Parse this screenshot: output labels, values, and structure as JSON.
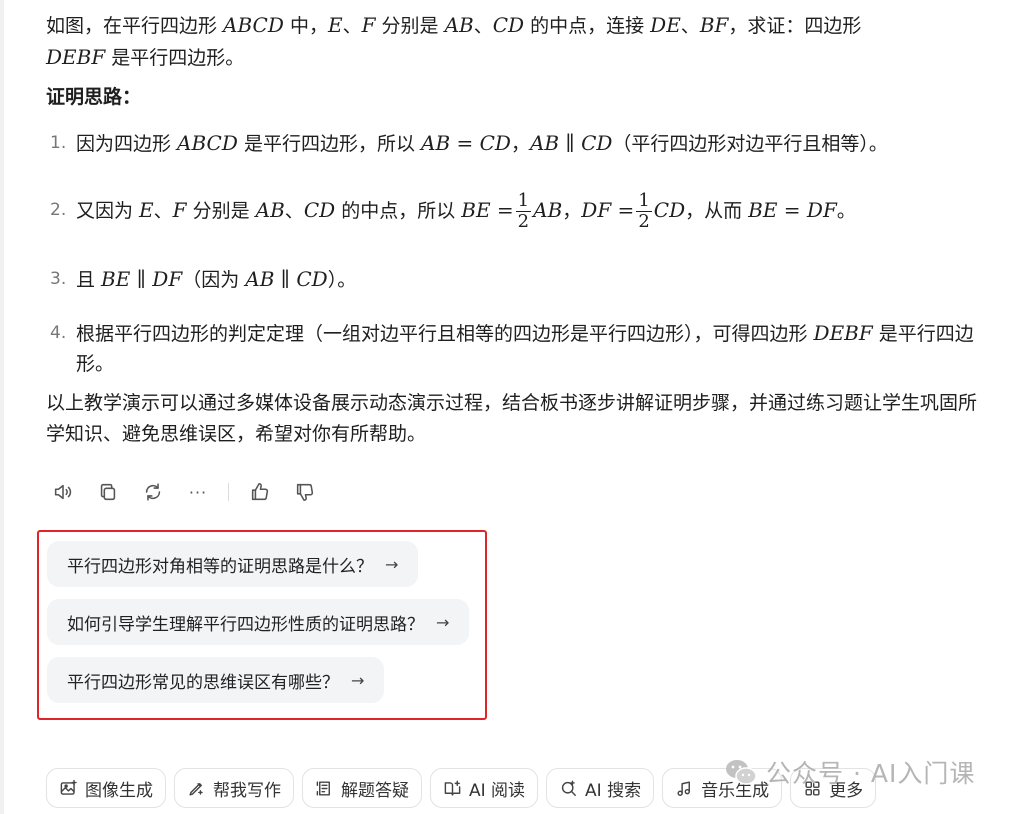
{
  "problem": {
    "t1": "如图，在平行四边形 ",
    "m1": "ABCD",
    "t2": " 中，",
    "m2": "E",
    "t3": "、",
    "m3": "F",
    "t4": " 分别是 ",
    "m4": "AB",
    "t5": "、",
    "m5": "CD",
    "t6": " 的中点，连接 ",
    "m6": "DE",
    "t7": "、",
    "m7": "BF",
    "t8": "，求证：四边形",
    "m8": "DEBF",
    "t9": " 是平行四边形。"
  },
  "heading": {
    "label": "证明思路",
    "colon": "："
  },
  "steps": [
    {
      "number": "1.",
      "a": "因为四边形 ",
      "m1": "ABCD",
      "b": " 是平行四边形，所以 ",
      "m2": "AB = CD",
      "c": "，",
      "m3": "AB ∥ CD",
      "d": "（平行四边形对边平行且相等）。"
    },
    {
      "number": "2.",
      "a": "又因为 ",
      "m1": "E",
      "b": "、",
      "m2": "F",
      "c": " 分别是 ",
      "m3": "AB",
      "d": "、",
      "m4": "CD",
      "e": " 的中点，所以 ",
      "m5": "BE =",
      "frac_num": "1",
      "frac_den": "2",
      "m6": "AB",
      "f": "，",
      "m7": "DF =",
      "m8": "CD",
      "g": "，从而 ",
      "m9": "BE = DF",
      "h": "。"
    },
    {
      "number": "3.",
      "a": "且 ",
      "m1": "BE ∥ DF",
      "b": "（因为 ",
      "m2": "AB ∥ CD",
      "c": "）。"
    },
    {
      "number": "4.",
      "a": "根据平行四边形的判定定理（一组对边平行且相等的四边形是平行四边形），可得四边形 ",
      "m1": "DEBF",
      "b": " 是平行四边形。"
    }
  ],
  "summary": "以上教学演示可以通过多媒体设备展示动态演示过程，结合板书逐步讲解证明步骤，并通过练习题让学生巩固所学知识、避免思维误区，希望对你有所帮助。",
  "actions": {
    "icons": [
      "speaker-icon",
      "copy-icon",
      "refresh-icon",
      "more-icon",
      "thumbs-up-icon",
      "thumbs-down-icon"
    ],
    "more_label": "···"
  },
  "suggestions": [
    {
      "label": "平行四边形对角相等的证明思路是什么？",
      "arrow": "→"
    },
    {
      "label": "如何引导学生理解平行四边形性质的证明思路？",
      "arrow": "→"
    },
    {
      "label": "平行四边形常见的思维误区有哪些？",
      "arrow": "→"
    }
  ],
  "tools": [
    {
      "label": "图像生成",
      "icon": "image-icon"
    },
    {
      "label": "帮我写作",
      "icon": "pen-icon"
    },
    {
      "label": "解题答疑",
      "icon": "solve-icon"
    },
    {
      "label": "AI 阅读",
      "icon": "book-icon"
    },
    {
      "label": "AI 搜索",
      "icon": "search-icon"
    },
    {
      "label": "音乐生成",
      "icon": "music-icon"
    },
    {
      "label": "更多",
      "icon": "grid-icon"
    }
  ],
  "watermark": "公众号 · AI入门课",
  "colors": {
    "highlight_border": "#e0242a",
    "chip_bg": "#f3f4f6"
  }
}
